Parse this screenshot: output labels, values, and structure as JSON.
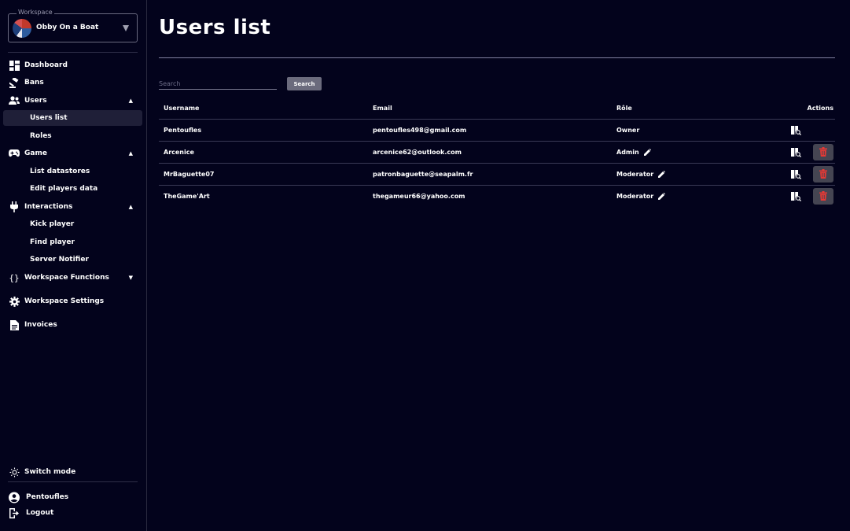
{
  "sidebar": {
    "workspace_legend": "Workspace",
    "workspace_name": "Obby On a Boat",
    "items": [
      {
        "label": "Dashboard",
        "icon": "dashboard-icon"
      },
      {
        "label": "Bans",
        "icon": "gavel-icon"
      },
      {
        "label": "Users",
        "icon": "users-icon",
        "expanded": true
      },
      {
        "label": "Users list",
        "active": true
      },
      {
        "label": "Roles"
      },
      {
        "label": "Game",
        "icon": "gamepad-icon",
        "expanded": true
      },
      {
        "label": "List datastores"
      },
      {
        "label": "Edit players data"
      },
      {
        "label": "Interactions",
        "icon": "plug-icon",
        "expanded": true
      },
      {
        "label": "Kick player"
      },
      {
        "label": "Find player"
      },
      {
        "label": "Server Notifier"
      },
      {
        "label": "Workspace Functions",
        "icon": "braces-icon",
        "expanded": false
      },
      {
        "label": "Workspace Settings",
        "icon": "gear-icon"
      },
      {
        "label": "Invoices",
        "icon": "document-icon"
      }
    ],
    "switch_mode": "Switch mode",
    "user_name": "Pentoufles",
    "logout": "Logout"
  },
  "main": {
    "title": "Users list",
    "search": {
      "placeholder": "Search",
      "button": "Search"
    },
    "table": {
      "headers": {
        "username": "Username",
        "email": "Email",
        "role": "Rôle",
        "actions": "Actions"
      },
      "rows": [
        {
          "username": "Pentoufles",
          "email": "pentoufles498@gmail.com",
          "role": "Owner",
          "editable": false,
          "deletable": false
        },
        {
          "username": "Arcenice",
          "email": "arcenice62@outlook.com",
          "role": "Admin",
          "editable": true,
          "deletable": true
        },
        {
          "username": "MrBaguette07",
          "email": "patronbaguette@seapalm.fr",
          "role": "Moderator",
          "editable": true,
          "deletable": true
        },
        {
          "username": "TheGame'Art",
          "email": "thegameur66@yahoo.com",
          "role": "Moderator",
          "editable": true,
          "deletable": true
        }
      ]
    }
  },
  "colors": {
    "background": "#03031c",
    "delete_icon": "#e53935",
    "button_bg": "#6b6b7d"
  }
}
